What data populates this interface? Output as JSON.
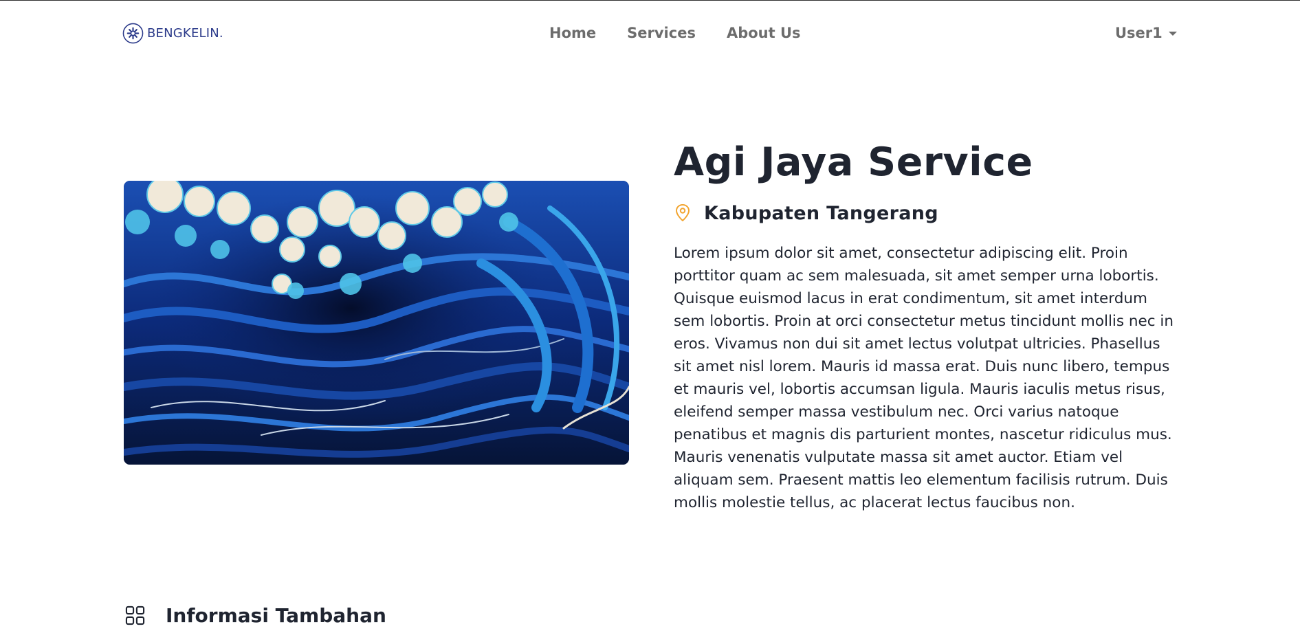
{
  "navbar": {
    "brand_name": "BENGKELIN.",
    "brand_color": "#2b3a8a",
    "links": [
      {
        "label": "Home"
      },
      {
        "label": "Services"
      },
      {
        "label": "About Us"
      }
    ],
    "user": {
      "name": "User1",
      "icon": "chevron-down-icon"
    }
  },
  "service": {
    "title": "Agi Jaya Service",
    "location_icon": "map-pin-icon",
    "location_icon_color": "#f2a531",
    "location": "Kabupaten Tangerang",
    "image_description": "Stylized blue ocean wave illustration",
    "description": "Lorem ipsum dolor sit amet, consectetur adipiscing elit. Proin porttitor quam ac sem malesuada, sit amet semper urna lobortis. Quisque euismod lacus in erat condimentum, sit amet interdum sem lobortis. Proin at orci consectetur metus tincidunt mollis nec in eros. Vivamus non dui sit amet lectus volutpat ultricies. Phasellus sit amet nisl lorem. Mauris id massa erat. Duis nunc libero, tempus et mauris vel, lobortis accumsan ligula. Mauris iaculis metus risus, eleifend semper massa vestibulum nec. Orci varius natoque penatibus et magnis dis parturient montes, nascetur ridiculus mus. Mauris venenatis vulputate massa sit amet auctor. Etiam vel aliquam sem. Praesent mattis leo elementum facilisis rutrum. Duis mollis molestie tellus, ac placerat lectus faucibus non."
  },
  "additional_info": {
    "icon": "grid-icon",
    "title": "Informasi Tambahan"
  }
}
